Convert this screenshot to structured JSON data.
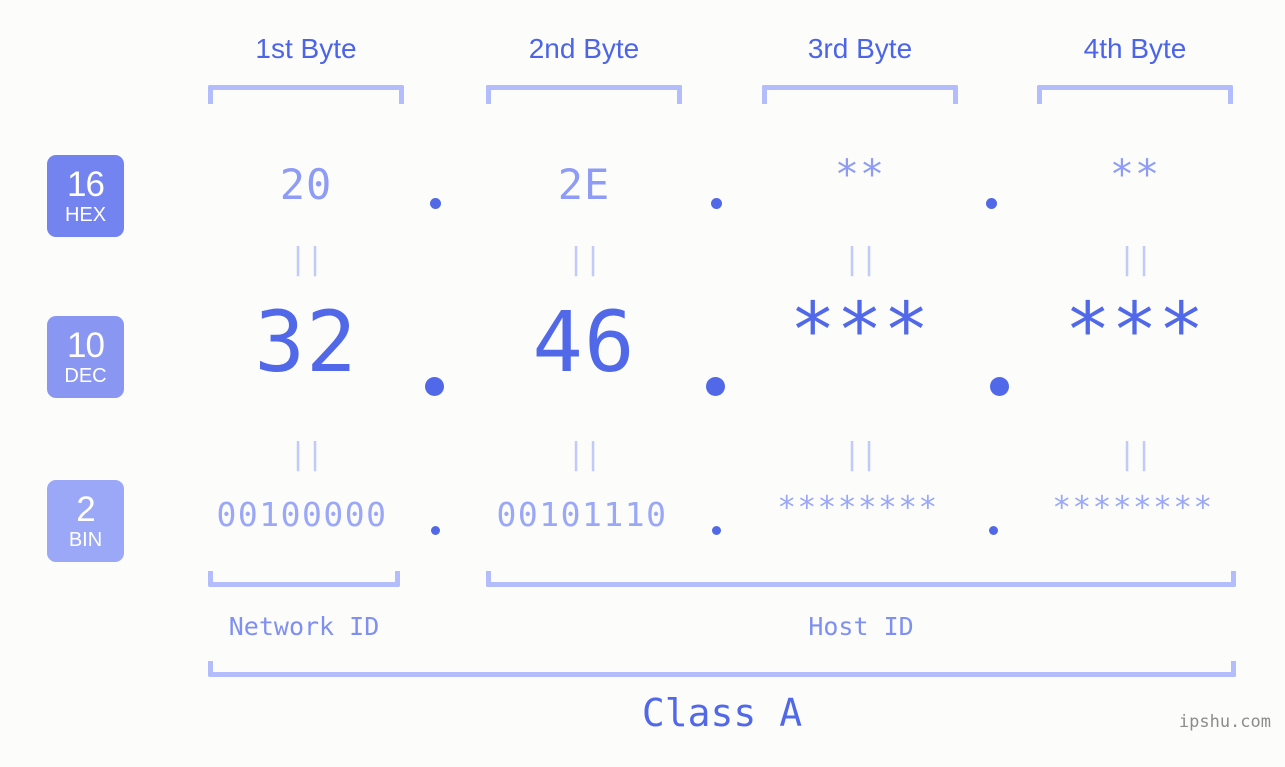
{
  "meta": {
    "background_color": "#fcfdfa",
    "accent_strong": "#5169e8",
    "accent_mid": "#8e9cf5",
    "accent_light": "#b3bdfb",
    "watermark": "ipshu.com"
  },
  "byte_headers": [
    {
      "label": "1st Byte"
    },
    {
      "label": "2nd Byte"
    },
    {
      "label": "3rd Byte"
    },
    {
      "label": "4th Byte"
    }
  ],
  "radix_badges": [
    {
      "number": "16",
      "name": "HEX",
      "color": "#7384f0"
    },
    {
      "number": "10",
      "name": "DEC",
      "color": "#8997f3"
    },
    {
      "number": "2",
      "name": "BIN",
      "color": "#9aa8f7"
    }
  ],
  "rows": {
    "hex": {
      "radix": "16",
      "radix_name": "HEX",
      "values": [
        "20",
        "2E",
        "**",
        "**"
      ],
      "separators": [
        ".",
        ".",
        "."
      ]
    },
    "dec": {
      "radix": "10",
      "radix_name": "DEC",
      "values": [
        "32",
        "46",
        "***",
        "***"
      ],
      "separators": [
        ".",
        ".",
        "."
      ]
    },
    "bin": {
      "radix": "2",
      "radix_name": "BIN",
      "values": [
        "00100000",
        "00101110",
        "********",
        "********"
      ],
      "separators": [
        ".",
        ".",
        "."
      ]
    }
  },
  "equality_markers": {
    "glyph": "||",
    "count_per_row": 4
  },
  "id_sections": [
    {
      "label": "Network ID"
    },
    {
      "label": "Host ID"
    }
  ],
  "class_section": {
    "label": "Class A"
  }
}
